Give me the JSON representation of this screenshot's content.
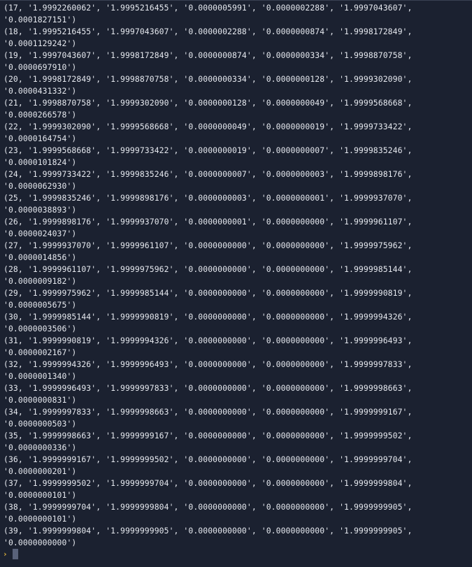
{
  "terminal": {
    "lines": [
      "(17, '1.9992260062', '1.9995216455', '0.0000005991', '0.0000002288', '1.9997043607',",
      "'0.0001827151')",
      "(18, '1.9995216455', '1.9997043607', '0.0000002288', '0.0000000874', '1.9998172849',",
      "'0.0001129242')",
      "(19, '1.9997043607', '1.9998172849', '0.0000000874', '0.0000000334', '1.9998870758',",
      "'0.0000697910')",
      "(20, '1.9998172849', '1.9998870758', '0.0000000334', '0.0000000128', '1.9999302090',",
      "'0.0000431332')",
      "(21, '1.9998870758', '1.9999302090', '0.0000000128', '0.0000000049', '1.9999568668',",
      "'0.0000266578')",
      "(22, '1.9999302090', '1.9999568668', '0.0000000049', '0.0000000019', '1.9999733422',",
      "'0.0000164754')",
      "(23, '1.9999568668', '1.9999733422', '0.0000000019', '0.0000000007', '1.9999835246',",
      "'0.0000101824')",
      "(24, '1.9999733422', '1.9999835246', '0.0000000007', '0.0000000003', '1.9999898176',",
      "'0.0000062930')",
      "(25, '1.9999835246', '1.9999898176', '0.0000000003', '0.0000000001', '1.9999937070',",
      "'0.0000038893')",
      "(26, '1.9999898176', '1.9999937070', '0.0000000001', '0.0000000000', '1.9999961107',",
      "'0.0000024037')",
      "(27, '1.9999937070', '1.9999961107', '0.0000000000', '0.0000000000', '1.9999975962',",
      "'0.0000014856')",
      "(28, '1.9999961107', '1.9999975962', '0.0000000000', '0.0000000000', '1.9999985144',",
      "'0.0000009182')",
      "(29, '1.9999975962', '1.9999985144', '0.0000000000', '0.0000000000', '1.9999990819',",
      "'0.0000005675')",
      "(30, '1.9999985144', '1.9999990819', '0.0000000000', '0.0000000000', '1.9999994326',",
      "'0.0000003506')",
      "(31, '1.9999990819', '1.9999994326', '0.0000000000', '0.0000000000', '1.9999996493',",
      "'0.0000002167')",
      "(32, '1.9999994326', '1.9999996493', '0.0000000000', '0.0000000000', '1.9999997833',",
      "'0.0000001340')",
      "(33, '1.9999996493', '1.9999997833', '0.0000000000', '0.0000000000', '1.9999998663',",
      "'0.0000000831')",
      "(34, '1.9999997833', '1.9999998663', '0.0000000000', '0.0000000000', '1.9999999167',",
      "'0.0000000503')",
      "(35, '1.9999998663', '1.9999999167', '0.0000000000', '0.0000000000', '1.9999999502',",
      "'0.0000000336')",
      "(36, '1.9999999167', '1.9999999502', '0.0000000000', '0.0000000000', '1.9999999704',",
      "'0.0000000201')",
      "(37, '1.9999999502', '1.9999999704', '0.0000000000', '0.0000000000', '1.9999999804',",
      "'0.0000000101')",
      "(38, '1.9999999704', '1.9999999804', '0.0000000000', '0.0000000000', '1.9999999905',",
      "'0.0000000101')",
      "(39, '1.9999999804', '1.9999999905', '0.0000000000', '0.0000000000', '1.9999999905',",
      "'0.0000000000')"
    ],
    "prompt": {
      "icon": "prompt-arrow-icon",
      "glyph": "›",
      "color": "#e0b43c"
    },
    "colors": {
      "background": "#1b2130",
      "text": "#e6e9ef",
      "cursor": "#59627a"
    }
  }
}
